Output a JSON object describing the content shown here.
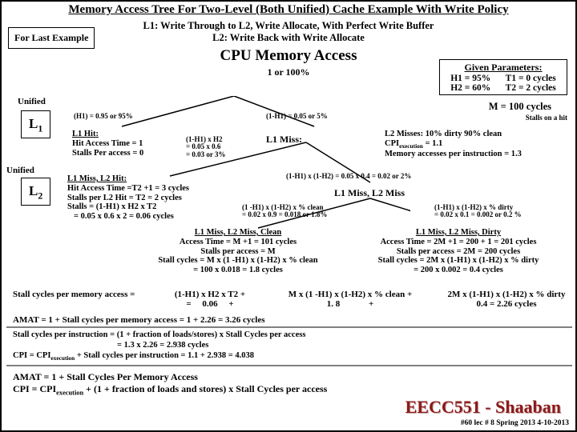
{
  "title": "Memory Access Tree For Two-Level (Both Unified) Cache Example With Write Policy",
  "subhead_l1": "L1: Write Through to L2, Write Allocate, With Perfect Write Buffer",
  "subhead_l2": "L2: Write Back with Write Allocate",
  "for_last": "For Last Example",
  "cpu_access": "CPU Memory  Access",
  "pct": "1 or 100%",
  "unified": "Unified",
  "L1": "L",
  "L1sub": "1",
  "L2": "L",
  "L2sub": "2",
  "given": {
    "title": "Given Parameters:",
    "h1": "H1  = 95%",
    "t1": "T1  = 0 cycles",
    "h2": "H2  = 60%",
    "t2": "T2  = 2 cycles"
  },
  "m_cycles": "M = 100 cycles",
  "stalls_hit": "Stalls on a hit",
  "h1_ann": "(H1) = 0.95 or 95%",
  "one_mh1": "(1-H1) = 0.05 or 5%",
  "l1hit": {
    "title": "L1 Hit:",
    "l1": "Hit Access Time = 1",
    "l2": "Stalls Per access = 0"
  },
  "mid_calc": {
    "l1": "(1-H1) x H2",
    "l2": "= 0.05 x 0.6",
    "l3": "= 0.03 or 3%"
  },
  "l1miss": "L1 Miss:",
  "rightinfo": {
    "l1": "L2 Misses:   10% dirty   90% clean",
    "l2a": "CPI",
    "l2sub": "execution",
    "l2b": " = 1.1",
    "l3": "Memory accesses per instruction = 1.3"
  },
  "l2hit": {
    "title": "L1 Miss, L2 Hit:",
    "l1": "Hit Access Time =T2 +1 = 3 cycles",
    "l2": "Stalls per L2 Hit = T2 = 2 cycles",
    "l3": "Stalls =  (1-H1) x H2 x T2",
    "l4": "=  0.05 x 0.6 x 2 =  0.06 cycles"
  },
  "mid2": {
    "l1": "(1-H1) x (1-H2) = 0.05 x 0.4 = 0.02 or 2%"
  },
  "l1l2miss": "L1 Miss, L2 Miss",
  "clean_calc": {
    "l1": "(1 -H1)  x (1-H2) x % clean",
    "l2": "= 0.02 x 0.9 = 0.018  or 1.8%"
  },
  "dirty_calc": {
    "l1": "(1-H1)  x (1-H2)  x  % dirty",
    "l2": "= 0.02  x 0.1 =  0.002  or 0.2 %"
  },
  "cleanblk": {
    "title": "L1 Miss, L2  Miss,  Clean",
    "l1": "Access Time =  M +1 = 101 cycles",
    "l2": "Stalls per access = M",
    "l3": "Stall cycles = M x (1 -H1)  x (1-H2) x  %  clean",
    "l4": "= 100 x 0.018 = 1.8  cycles"
  },
  "dirtyblk": {
    "title": "L1 Miss, L2  Miss,  Dirty",
    "l1": "Access Time =  2M +1 = 200 + 1 = 201 cycles",
    "l2": "Stalls per access = 2M  = 200 cycles",
    "l3": "Stall cycles = 2M x (1-H1)  x (1-H2) x  % dirty",
    "l4": "=  200 x 0.002 = 0.4 cycles"
  },
  "sumline": {
    "lhs": "Stall cycles per memory access  =",
    "p1a": "(1-H1) x H2 x T2  +",
    "p1b": "0.06",
    "p2a": "M x (1 -H1)  x (1-H2) x  %  clean  +",
    "p2b": "1. 8",
    "p3a": "2M x (1-H1)  x (1-H2) x % dirty",
    "p3b": "0.4       = 2.26 cycles",
    "eq": "=",
    "plus": "+"
  },
  "amat1": "AMAT =  1 +  Stall cycles per memory access = 1 + 2.26 = 3.26 cycles",
  "rules": {
    "l1": "Stall cycles per instruction = (1  +  fraction of loads/stores) x Stall Cycles per access",
    "l2": "= 1.3 x 2.26 =  2.938  cycles",
    "l3a": "CPI = CPI",
    "l3sub": "execution",
    "l3b": " + Stall cycles per instruction  =  1.1 + 2.938 =  4.038"
  },
  "amat": {
    "l1": "AMAT =   1 + Stall Cycles Per Memory Access",
    "l2a": "CPI = CPI",
    "l2sub": "execution",
    "l2b": "  + (1  + fraction of loads and stores) x Stall Cycles per access"
  },
  "footer_title": "EECC551 - Shaaban",
  "footer_sub": "#60  lec # 8   Spring 2013  4-10-2013"
}
